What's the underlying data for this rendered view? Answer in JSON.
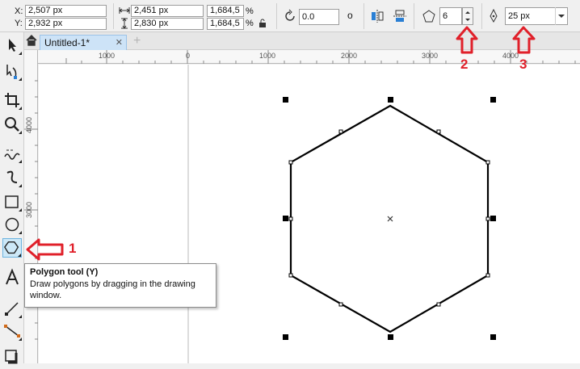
{
  "property_bar": {
    "x_label": "X:",
    "x_value": "2,507 px",
    "y_label": "Y:",
    "y_value": "2,932 px",
    "width_value": "2,451 px",
    "height_value": "2,830 px",
    "scale_x_value": "1,684,5",
    "scale_y_value": "1,684,5",
    "scale_unit": "%",
    "rotation_value": "0.0",
    "rotation_unit": "o",
    "sides_value": "6",
    "outline_value": "25 px"
  },
  "document": {
    "tab_label": "Untitled-1*"
  },
  "rulers": {
    "h_ticks": [
      "1000",
      "0",
      "1000",
      "2000",
      "3000",
      "4000"
    ],
    "v_ticks": [
      "4000",
      "3000"
    ]
  },
  "tooltip": {
    "title": "Polygon tool (Y)",
    "description": "Draw polygons by dragging in the drawing window."
  },
  "annotations": {
    "callout_1": "1",
    "callout_2": "2",
    "callout_3": "3",
    "color": "#e0202a"
  },
  "colors": {
    "selection_tool_bg": "#cde8f7",
    "tab_bg": "#cde3f7"
  }
}
